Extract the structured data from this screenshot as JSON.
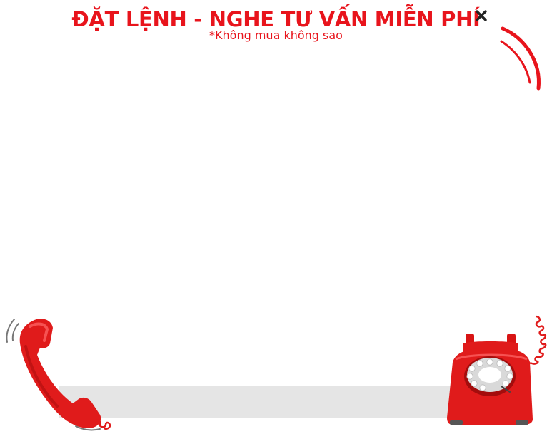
{
  "popup": {
    "title": "ĐẶT LỆNH - NGHE TƯ VẤN MIỄN PHÍ",
    "subtitle": "*Không mua không sao",
    "close_icon": "close-icon"
  },
  "illustrations": {
    "left": "ringing-handset-icon",
    "right": "rotary-phone-icon",
    "top_right": "ring-waves-icon"
  },
  "colors": {
    "accent": "#e8141c",
    "bar": "#e5e5e5",
    "background": "#ffffff"
  }
}
